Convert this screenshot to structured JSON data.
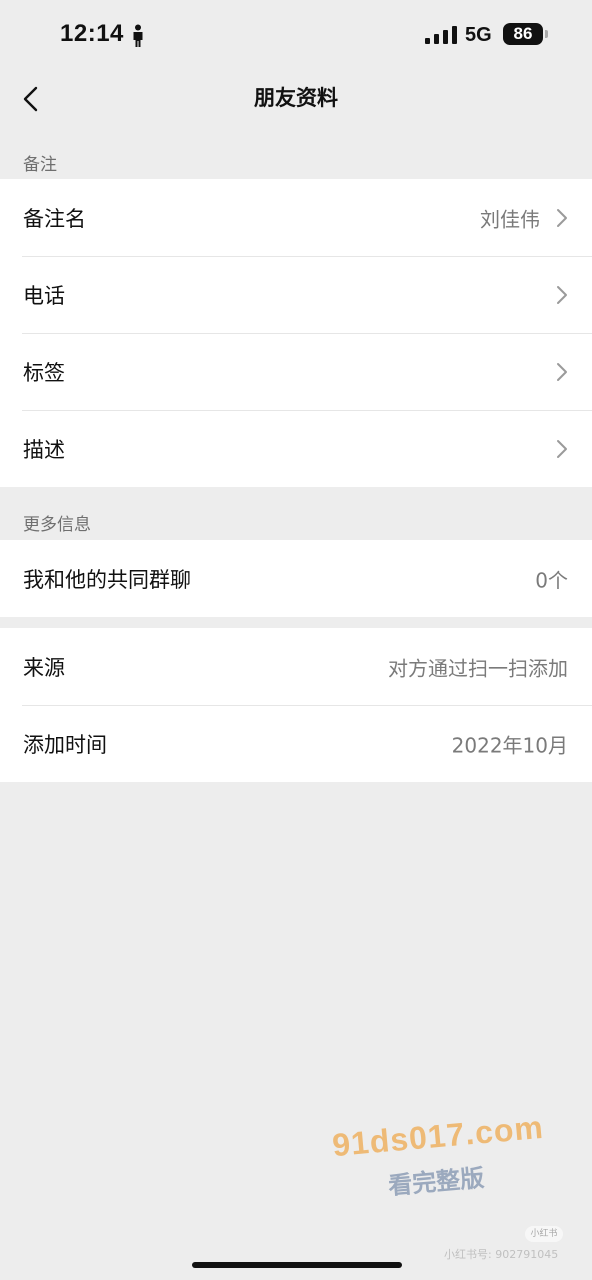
{
  "status_bar": {
    "time": "12:14",
    "network": "5G",
    "battery": "86",
    "icons": [
      "person-icon",
      "signal-icon",
      "battery-icon"
    ]
  },
  "nav": {
    "title": "朋友资料",
    "back_icon": "chevron-left-icon"
  },
  "sections": {
    "remark_header": "备注",
    "more_info_header": "更多信息"
  },
  "remark_group": {
    "remark_name_label": "备注名",
    "remark_name_value": "刘佳伟",
    "phone_label": "电话",
    "tags_label": "标签",
    "description_label": "描述"
  },
  "more_info_group": {
    "common_groups_label": "我和他的共同群聊",
    "common_groups_value": "0个"
  },
  "source_group": {
    "source_label": "来源",
    "source_value": "对方通过扫一扫添加",
    "added_time_label": "添加时间",
    "added_time_value": "2022年10月"
  },
  "watermark": {
    "url": "91ds017.com",
    "promo": "看完整版",
    "badge": "小红书",
    "id_text": "小红书号: 902791045"
  },
  "colors": {
    "background": "#ededed",
    "card": "#ffffff",
    "secondary_text": "#7a7a7a",
    "header_text": "#6f6f6f",
    "watermark_orange": "#eea84e"
  }
}
